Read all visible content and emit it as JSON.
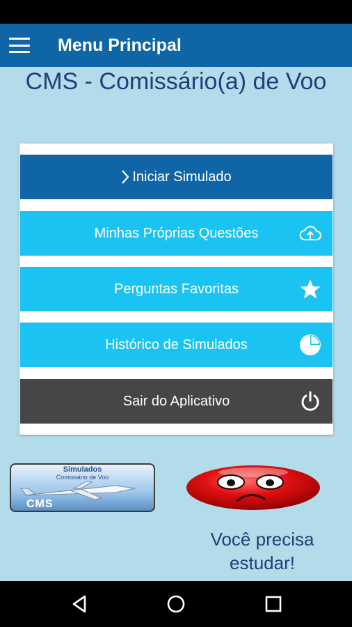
{
  "appbar": {
    "title": "Menu Principal",
    "menu_icon": "hamburger-menu-icon"
  },
  "heading": "CMS - Comissário(a) de Voo",
  "menu": {
    "start_label": "Iniciar Simulado",
    "own_questions_label": "Minhas Próprias Questões",
    "favorites_label": "Perguntas Favoritas",
    "history_label": "Histórico de Simulados",
    "exit_label": "Sair do Aplicativo"
  },
  "logo": {
    "title": "Simulados",
    "subtitle": "Comissário de Voo",
    "brand": "CMS"
  },
  "status_message": "Você precisa estudar!",
  "colors": {
    "primary": "#0f65a6",
    "accent": "#1ac3f2",
    "exit": "#464646",
    "background": "#b2dcea",
    "heading_text": "#263c7a",
    "smiley": "#e01010"
  },
  "icons": {
    "start": "chevron-right-icon",
    "own_questions": "cloud-upload-icon",
    "favorites": "star-icon",
    "history": "pie-chart-icon",
    "exit": "power-icon",
    "mood": "sad-face-icon",
    "nav_back": "back-triangle-icon",
    "nav_home": "home-circle-icon",
    "nav_recents": "recents-square-icon"
  }
}
